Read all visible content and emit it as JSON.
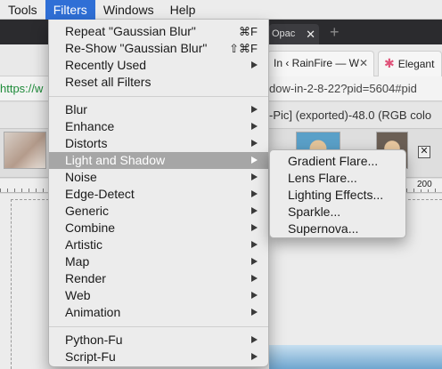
{
  "menubar": {
    "items": [
      "Tools",
      "Filters",
      "Windows",
      "Help"
    ],
    "active": "Filters"
  },
  "browser": {
    "dark_tab_title": "Opac",
    "bookmark_tabs": [
      "In ‹ RainFire — W",
      "Elegant"
    ],
    "url_prefix": "https://w",
    "url_tail": "dow-in-2-8-22?pid=5604#pid",
    "title_tail": "-Pic] (exported)-48.0 (RGB colo",
    "ruler_number": "200"
  },
  "filters_menu": {
    "top_items": [
      {
        "label": "Repeat \"Gaussian Blur\"",
        "shortcut": "⌘F"
      },
      {
        "label": "Re-Show \"Gaussian Blur\"",
        "shortcut": "⇧⌘F"
      },
      {
        "label": "Recently Used",
        "submenu": true
      },
      {
        "label": "Reset all Filters"
      }
    ],
    "category_items": [
      {
        "label": "Blur"
      },
      {
        "label": "Enhance"
      },
      {
        "label": "Distorts"
      },
      {
        "label": "Light and Shadow",
        "highlighted": true
      },
      {
        "label": "Noise"
      },
      {
        "label": "Edge-Detect"
      },
      {
        "label": "Generic"
      },
      {
        "label": "Combine"
      },
      {
        "label": "Artistic"
      },
      {
        "label": "Map"
      },
      {
        "label": "Render"
      },
      {
        "label": "Web"
      },
      {
        "label": "Animation"
      }
    ],
    "script_items": [
      {
        "label": "Python-Fu"
      },
      {
        "label": "Script-Fu"
      }
    ]
  },
  "light_and_shadow_submenu": {
    "items": [
      "Gradient Flare...",
      "Lens Flare...",
      "Lighting Effects...",
      "Sparkle...",
      "Supernova..."
    ]
  },
  "colors": {
    "menu_bg": "#ececec",
    "highlight": "#a6a6a6",
    "menubar_active": "#2f6fd6"
  }
}
